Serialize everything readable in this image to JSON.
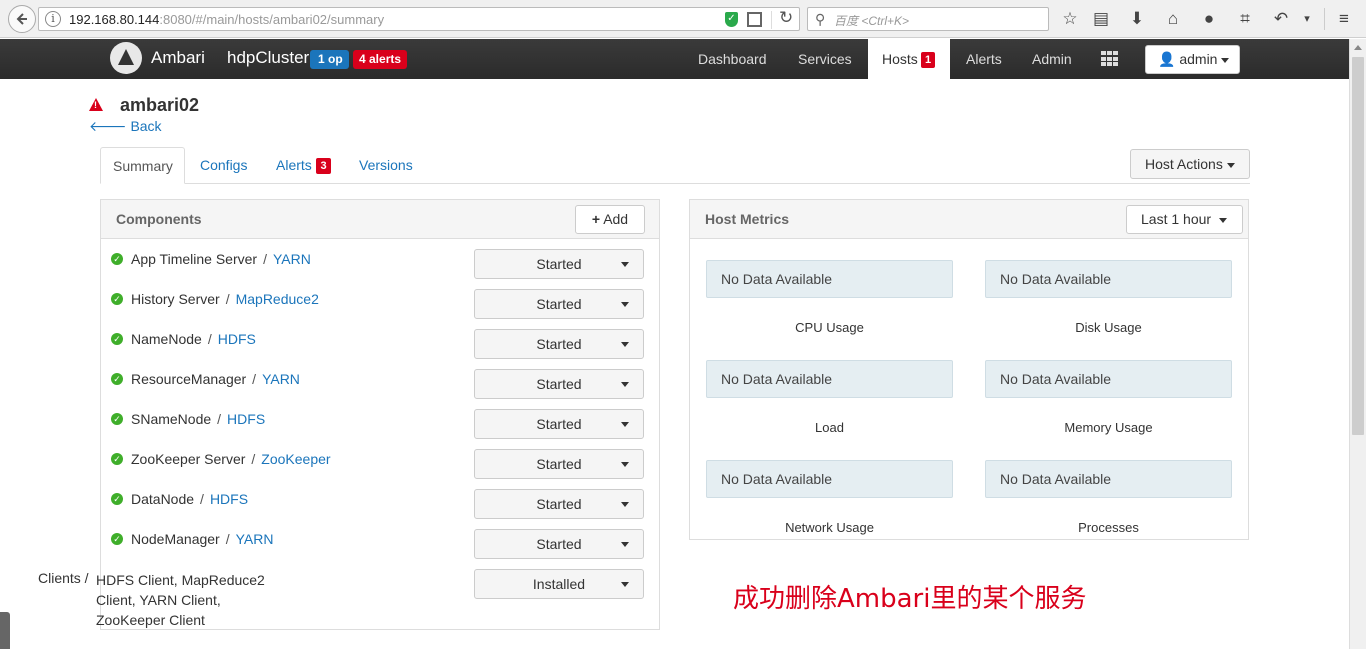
{
  "browser": {
    "url_host": "192.168.80.144",
    "url_rest": ":8080/#/main/hosts/ambari02/summary",
    "search_placeholder": "百度 <Ctrl+K>"
  },
  "navbar": {
    "brand": "Ambari",
    "cluster": "hdpCluster",
    "ops_badge": "1 op",
    "alerts_badge": "4 alerts",
    "items": [
      "Dashboard",
      "Services",
      "Hosts",
      "Alerts",
      "Admin"
    ],
    "hosts_badge": "1",
    "user": "admin"
  },
  "page": {
    "host_name": "ambari02",
    "back_label": "Back",
    "tabs": [
      "Summary",
      "Configs",
      "Alerts",
      "Versions"
    ],
    "alerts_tab_badge": "3",
    "host_actions_label": "Host Actions"
  },
  "components": {
    "title": "Components",
    "add_label": "Add",
    "rows": [
      {
        "name": "App Timeline Server",
        "service": "YARN",
        "state": "Started"
      },
      {
        "name": "History Server",
        "service": "MapReduce2",
        "state": "Started"
      },
      {
        "name": "NameNode",
        "service": "HDFS",
        "state": "Started"
      },
      {
        "name": "ResourceManager",
        "service": "YARN",
        "state": "Started"
      },
      {
        "name": "SNameNode",
        "service": "HDFS",
        "state": "Started"
      },
      {
        "name": "ZooKeeper Server",
        "service": "ZooKeeper",
        "state": "Started"
      },
      {
        "name": "DataNode",
        "service": "HDFS",
        "state": "Started"
      },
      {
        "name": "NodeManager",
        "service": "YARN",
        "state": "Started"
      }
    ],
    "separator": "/",
    "clients_label": "Clients /",
    "clients_list": "HDFS Client, MapReduce2 Client, YARN Client, ZooKeeper Client",
    "clients_state": "Installed"
  },
  "metrics": {
    "title": "Host Metrics",
    "range_label": "Last 1 hour",
    "no_data": "No Data Available",
    "labels": [
      "CPU Usage",
      "Disk Usage",
      "Load",
      "Memory Usage",
      "Network Usage",
      "Processes"
    ]
  },
  "annotation": "成功删除Ambari里的某个服务",
  "colors": {
    "link": "#1b75bb",
    "alert": "#d9001b",
    "ok": "#3fae2a"
  }
}
